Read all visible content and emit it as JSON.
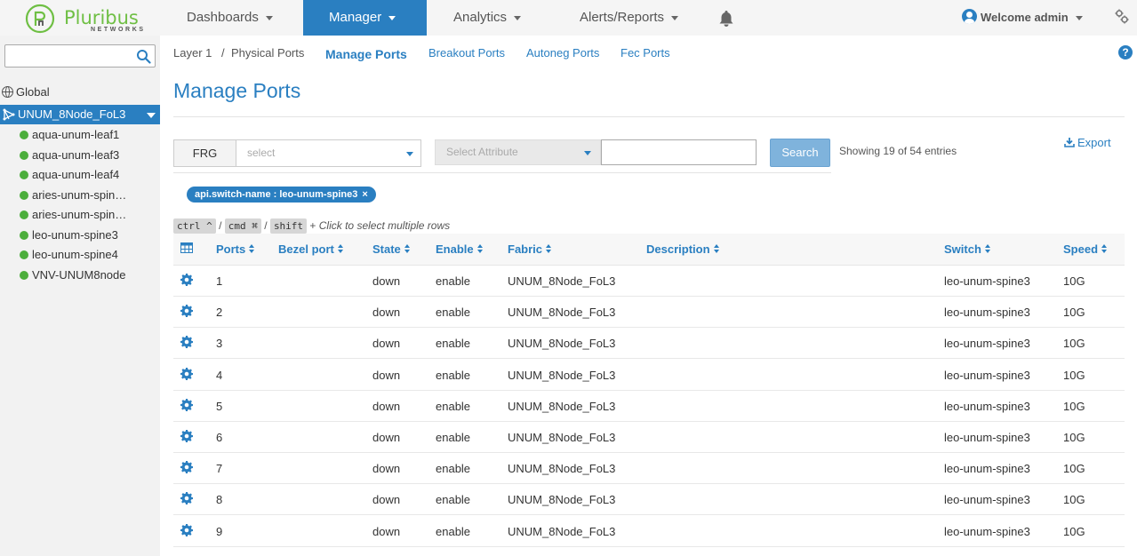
{
  "brand": {
    "name": "Pluribus",
    "sub": "NETWORKS"
  },
  "nav": {
    "items": [
      {
        "label": "Dashboards"
      },
      {
        "label": "Manager"
      },
      {
        "label": "Analytics"
      },
      {
        "label": "Alerts/Reports"
      }
    ],
    "active": "Manager",
    "welcome": "Welcome admin"
  },
  "sidebar": {
    "search_value": "",
    "global": "Global",
    "fabric": "UNUM_8Node_FoL3",
    "switches": [
      "aqua-unum-leaf1",
      "aqua-unum-leaf3",
      "aqua-unum-leaf4",
      "aries-unum-spin…",
      "aries-unum-spin…",
      "leo-unum-spine3",
      "leo-unum-spine4",
      "VNV-UNUM8node"
    ]
  },
  "breadcrumb": {
    "level1": "Layer 1",
    "sep": "/",
    "level2": "Physical Ports"
  },
  "tabs": [
    "Manage Ports",
    "Breakout Ports",
    "Autoneg Ports",
    "Fec Ports"
  ],
  "page_title": "Manage Ports",
  "filter": {
    "frg_label": "FRG",
    "frg_placeholder": "select",
    "attr_placeholder": "Select Attribute",
    "search_value": "",
    "search_button": "Search",
    "showing": "Showing 19 of 54 entries",
    "export": "Export",
    "chip": "api.switch-name : leo-unum-spine3",
    "chip_close": "×"
  },
  "hint": {
    "ctrl": "ctrl ^",
    "cmd": "cmd ⌘",
    "shift": "shift",
    "sep": "/",
    "plus": "+",
    "text": "Click to select multiple rows"
  },
  "table": {
    "columns": [
      "Ports",
      "Bezel port",
      "State",
      "Enable",
      "Fabric",
      "Description",
      "Switch",
      "Speed"
    ],
    "rows": [
      {
        "port": "1",
        "bezel": "",
        "state": "down",
        "enable": "enable",
        "fabric": "UNUM_8Node_FoL3",
        "description": "",
        "switch": "leo-unum-spine3",
        "speed": "10G"
      },
      {
        "port": "2",
        "bezel": "",
        "state": "down",
        "enable": "enable",
        "fabric": "UNUM_8Node_FoL3",
        "description": "",
        "switch": "leo-unum-spine3",
        "speed": "10G"
      },
      {
        "port": "3",
        "bezel": "",
        "state": "down",
        "enable": "enable",
        "fabric": "UNUM_8Node_FoL3",
        "description": "",
        "switch": "leo-unum-spine3",
        "speed": "10G"
      },
      {
        "port": "4",
        "bezel": "",
        "state": "down",
        "enable": "enable",
        "fabric": "UNUM_8Node_FoL3",
        "description": "",
        "switch": "leo-unum-spine3",
        "speed": "10G"
      },
      {
        "port": "5",
        "bezel": "",
        "state": "down",
        "enable": "enable",
        "fabric": "UNUM_8Node_FoL3",
        "description": "",
        "switch": "leo-unum-spine3",
        "speed": "10G"
      },
      {
        "port": "6",
        "bezel": "",
        "state": "down",
        "enable": "enable",
        "fabric": "UNUM_8Node_FoL3",
        "description": "",
        "switch": "leo-unum-spine3",
        "speed": "10G"
      },
      {
        "port": "7",
        "bezel": "",
        "state": "down",
        "enable": "enable",
        "fabric": "UNUM_8Node_FoL3",
        "description": "",
        "switch": "leo-unum-spine3",
        "speed": "10G"
      },
      {
        "port": "8",
        "bezel": "",
        "state": "down",
        "enable": "enable",
        "fabric": "UNUM_8Node_FoL3",
        "description": "",
        "switch": "leo-unum-spine3",
        "speed": "10G"
      },
      {
        "port": "9",
        "bezel": "",
        "state": "down",
        "enable": "enable",
        "fabric": "UNUM_8Node_FoL3",
        "description": "",
        "switch": "leo-unum-spine3",
        "speed": "10G"
      }
    ]
  },
  "colors": {
    "accent": "#2a7fc1",
    "brand": "#6fbf44",
    "status_dot": "#4cae3c"
  },
  "icons": [
    "search-icon",
    "bell-icon",
    "user-icon",
    "settings-icon",
    "globe-icon",
    "fabric-icon",
    "help-icon",
    "export-icon",
    "column-grid-icon",
    "gear-icon",
    "sort-icon"
  ]
}
